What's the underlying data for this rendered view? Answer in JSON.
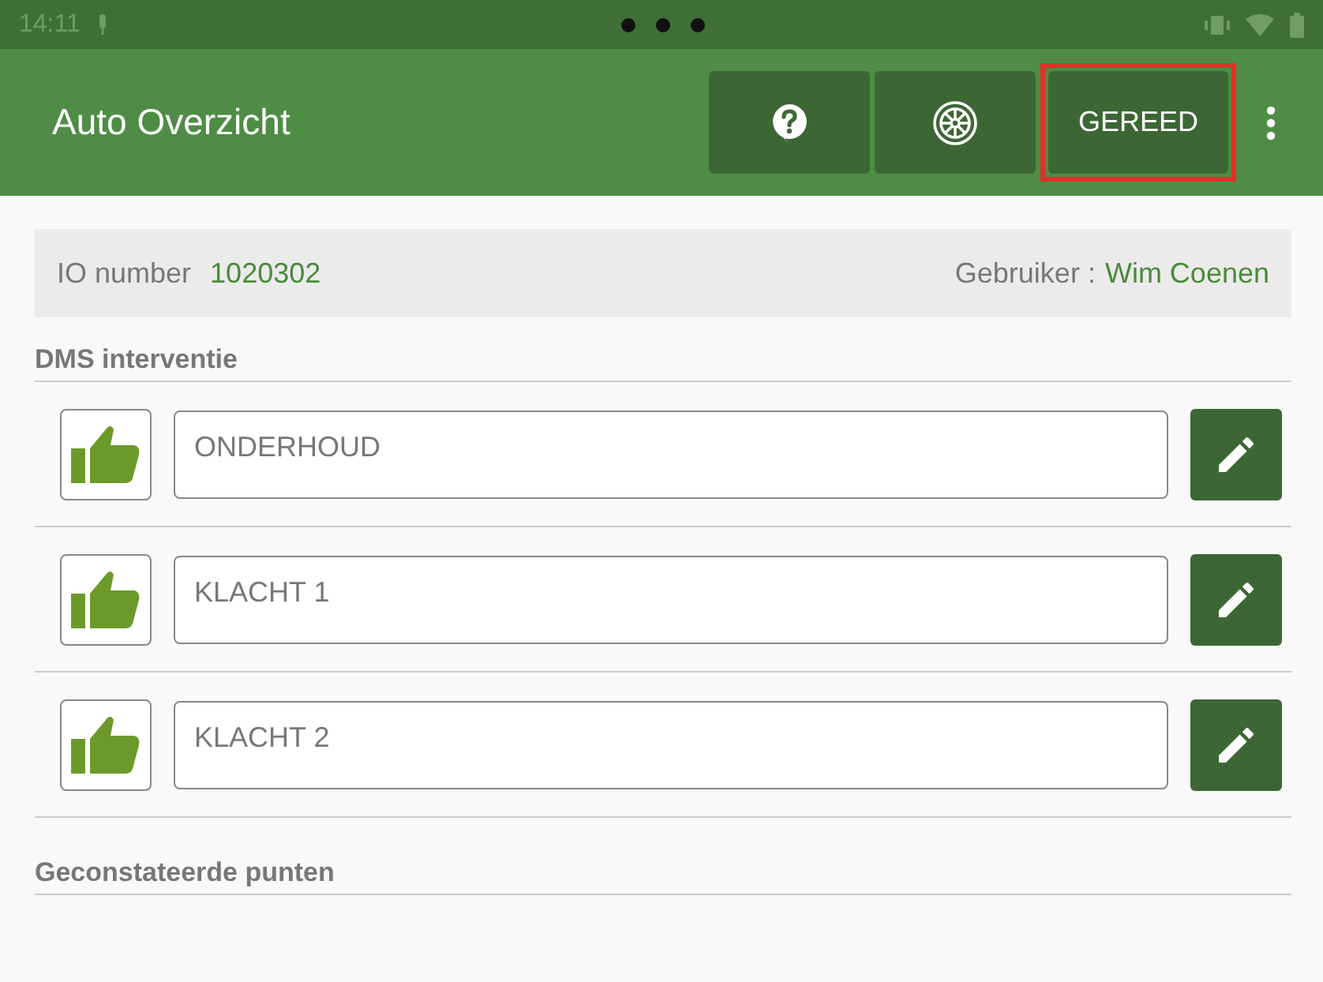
{
  "status_bar": {
    "time": "14:11"
  },
  "app_bar": {
    "title": "Auto Overzicht",
    "done_button": {
      "label": "GEREED",
      "highlighted": true
    }
  },
  "info": {
    "io_label": "IO number",
    "io_value": "1020302",
    "user_label": "Gebruiker :",
    "user_value": "Wim Coenen"
  },
  "sections": [
    {
      "title": "DMS interventie",
      "items": [
        {
          "text": "ONDERHOUD",
          "approved": true
        },
        {
          "text": "KLACHT 1",
          "approved": true
        },
        {
          "text": "KLACHT 2",
          "approved": true
        }
      ]
    },
    {
      "title": "Geconstateerde punten"
    }
  ]
}
